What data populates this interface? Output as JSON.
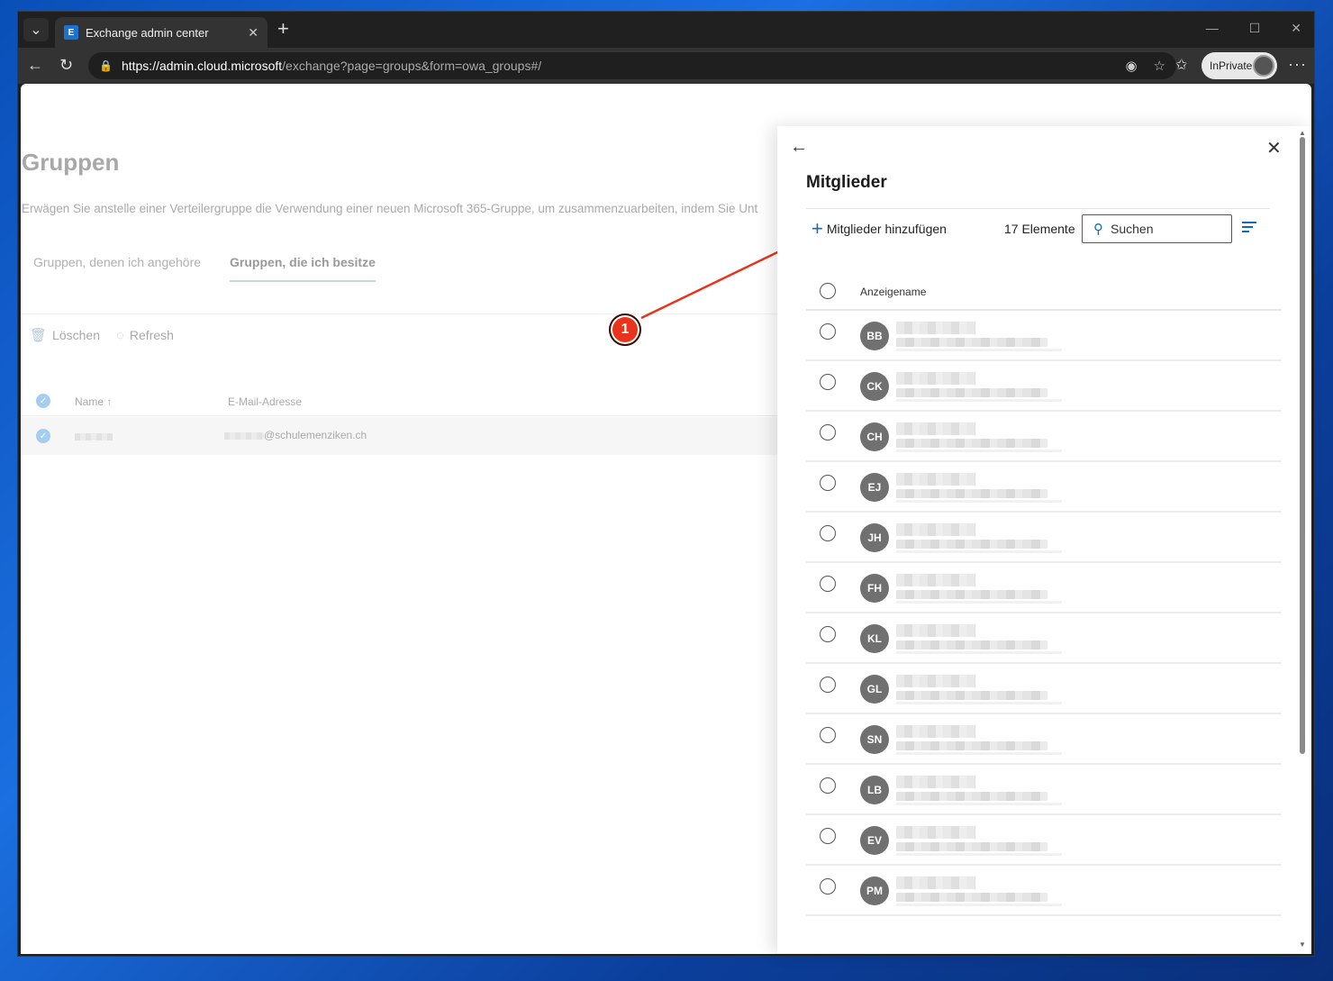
{
  "browser": {
    "tab_title": "Exchange admin center",
    "tab_icon": "E",
    "url_host": "https://admin.cloud.microsoft",
    "url_path": "/exchange?page=groups&form=owa_groups#/",
    "inprivate_label": "InPrivate"
  },
  "page": {
    "title": "Gruppen",
    "description": "Erwägen Sie anstelle einer Verteilergruppe die Verwendung einer neuen Microsoft 365-Gruppe, um zusammenzuarbeiten, indem Sie Unt",
    "tabs": [
      {
        "label": "Gruppen, denen ich angehöre",
        "active": false
      },
      {
        "label": "Gruppen, die ich besitze",
        "active": true
      }
    ],
    "commands": {
      "delete_label": "Löschen",
      "refresh_label": "Refresh"
    },
    "columns": {
      "name": "Name ↑",
      "email": "E-Mail-Adresse"
    },
    "row": {
      "email_suffix": "@schulemenziken.ch"
    }
  },
  "annotation": {
    "step": "1",
    "color": "#e8341c"
  },
  "panel": {
    "title": "Mitglieder",
    "add_label": "Mitglieder hinzufügen",
    "count_label": "17 Elemente",
    "search_placeholder": "Suchen",
    "column_label": "Anzeigename",
    "members": [
      {
        "initials": "BB"
      },
      {
        "initials": "CK"
      },
      {
        "initials": "CH"
      },
      {
        "initials": "EJ"
      },
      {
        "initials": "JH"
      },
      {
        "initials": "FH"
      },
      {
        "initials": "KL"
      },
      {
        "initials": "GL"
      },
      {
        "initials": "SN"
      },
      {
        "initials": "LB"
      },
      {
        "initials": "EV"
      },
      {
        "initials": "PM"
      }
    ]
  }
}
